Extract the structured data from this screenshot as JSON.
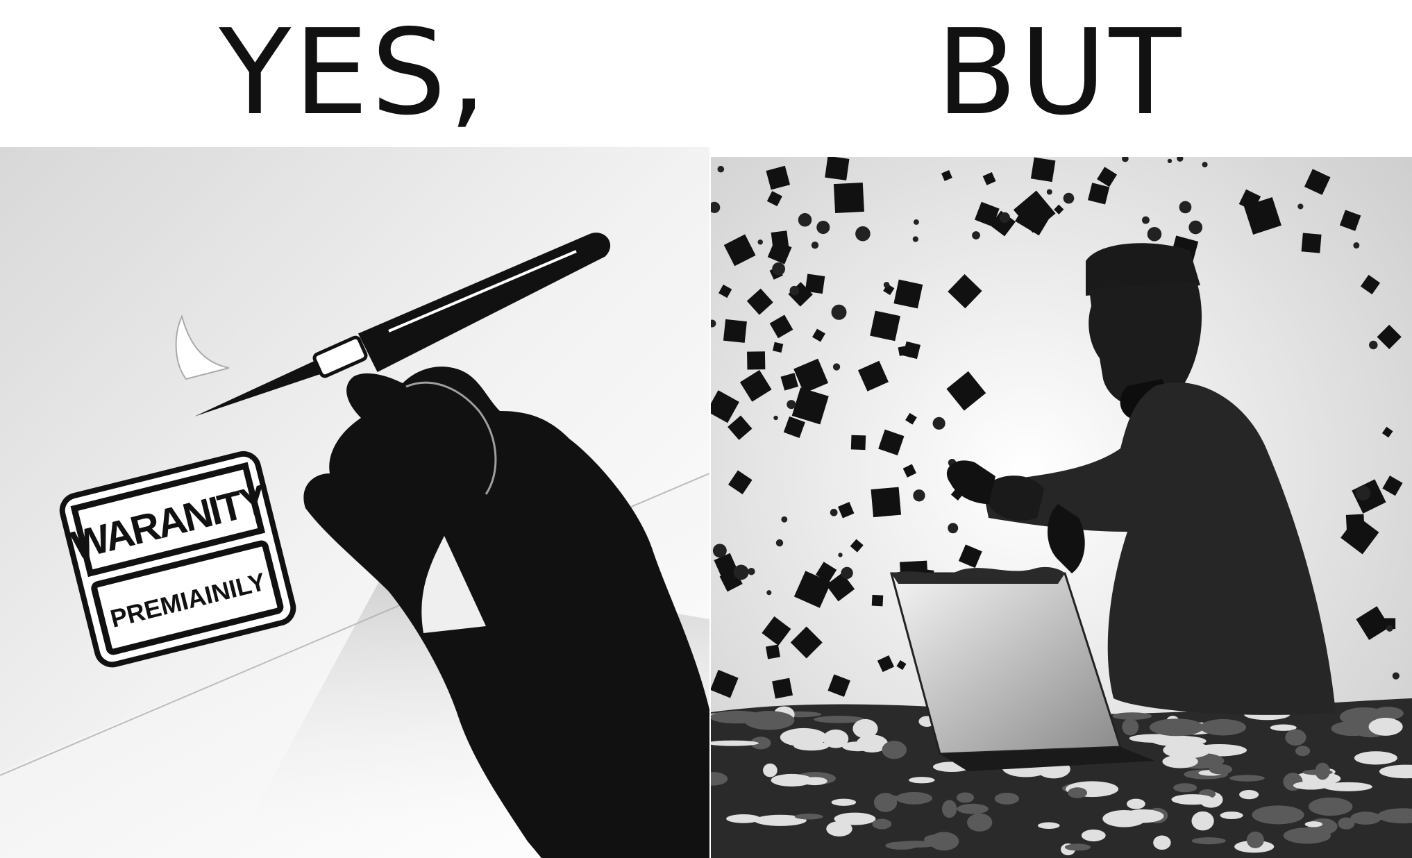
{
  "captions": {
    "left": "YES,",
    "right": "BUT"
  },
  "left_panel": {
    "sticker": {
      "line1": "WARANITY",
      "line2": "PREMIAINILY"
    }
  },
  "colors": {
    "ink": "#111111",
    "paper": "#efefef",
    "background": "#ffffff"
  }
}
